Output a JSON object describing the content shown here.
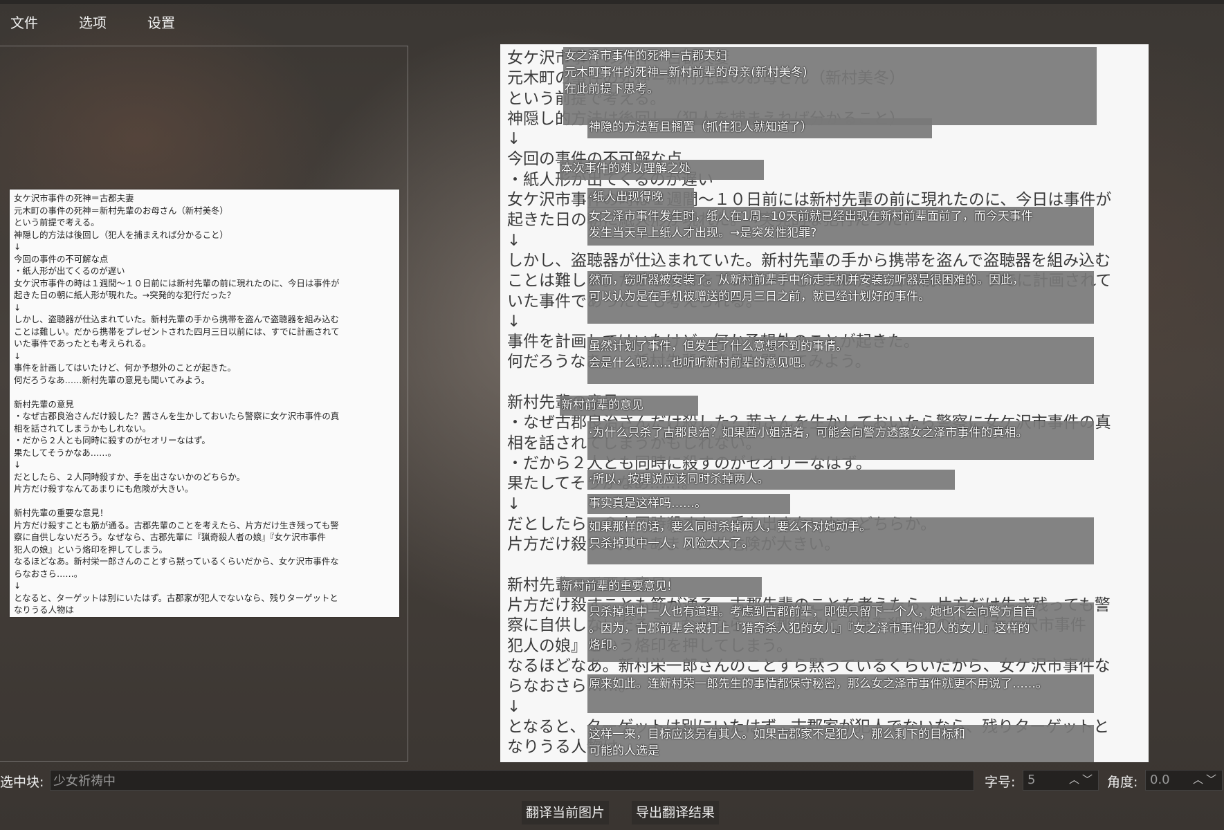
{
  "menu": {
    "file": "文件",
    "options": "选项",
    "settings": "设置"
  },
  "left_image_text": "女ケ沢市事件の死神＝古郡夫妻\n元木町の事件の死神＝新村先輩のお母さん（新村美冬）\nという前提で考える。\n神隠し的方法は後回し（犯人を捕まえれば分かること）\n↓\n今回の事件の不可解な点\n・紙人形が出てくるのが遅い\n女ケ沢市事件の時は１週間〜１０日前には新村先輩の前に現れたのに、今日は事件が\n起きた日の朝に紙人形が現れた。→突発的な犯行だった？\n↓\nしかし、盗聴器が仕込まれていた。新村先輩の手から携帯を盗んで盗聴器を組み込む\nことは難しい。だから携帯をプレゼントされた四月三日以前には、すでに計画されて\nいた事件であったとも考えられる。\n↓\n事件を計画してはいたけど、何か予想外のことが起きた。\n何だろうなあ……新村先輩の意見も聞いてみよう。\n\n新村先輩の意見\n・なぜ古郡良治さんだけ殺した？茜さんを生かしておいたら警察に女ケ沢市事件の真\n相を話されてしまうかもしれない。\n・だから２人とも同時に殺すのがセオリーなはず。\n果たしてそうかなあ……。\n↓\nだとしたら、２人同時殺すか、手を出さないかのどちらか。\n片方だけ殺すなんてあまりにも危険が大きい。\n\n新村先輩の重要な意見！\n片方だけ殺すことも筋が通る。古郡先輩のことを考えたら、片方だけ生き残っても警\n察に自供しないだろう。なぜなら、古郡先輩に『猟奇殺人者の娘』『女ケ沢市事件\n犯人の娘』という烙印を押してしまう。\nなるほどなあ。新村栄一郎さんのことすら黙っているくらいだから、女ケ沢市事件な\nらなおさら……。\n↓\nとなると、ターゲットは別にいたはず。古郡家が犯人でないなら、残りターゲットと\nなりうる人物は",
  "right_image_text": "女ケ沢市事件の死神＝古郡夫妻\n元木町の事件の死神＝新村先輩のお母さん（新村美冬）\nという前提で考える。\n神隠し的方法は後回し（犯人を捕まえれば分かること）\n↓\n今回の事件の不可解な点\n・紙人形が出てくるのが遅い\n女ケ沢市事件の時は１週間〜１０日前には新村先輩の前に現れたのに、今日は事件が\n起きた日の朝に紙人形が現れた。→突発的な犯行だった？\n↓\nしかし、盗聴器が仕込まれていた。新村先輩の手から携帯を盗んで盗聴器を組み込む\nことは難しい。だから携帯をプレゼントされた四月三日以前には、すでに計画されて\nいた事件であったとも考えられる。\n↓\n事件を計画してはいたけど、何か予想外のことが起きた。\n何だろうなあ……新村先輩の意見も聞いてみよう。\n\n新村先輩の意見\n・なぜ古郡良治さんだけ殺した？茜さんを生かしておいたら警察に女ケ沢市事件の真\n相を話されてしまうかもしれない。\n・だから２人とも同時に殺すのがセオリーなはず。\n果たしてそうかなあ……。\n↓\nだとしたら、２人同時殺すか、手を出さないかのどちらか。\n片方だけ殺すなんてあまりにも危険が大きい。\n\n新村先輩の重要な意見！\n片方だけ殺すことも筋が通る。古郡先輩のことを考えたら、片方だけ生き残っても警\n察に自供しないだろう。なぜなら、古郡先輩に『猟奇殺人者の娘』『女ケ沢市事件\n犯人の娘』という烙印を押してしまう。\nなるほどなあ。新村栄一郎さんのことすら黙っているくらいだから、女ケ沢市事件な\nらなおさら……。\n↓\nとなると、ターゲットは別にいたはず。古郡家が犯人でないなら、残りターゲットと\nなりうる人物は",
  "translations": [
    "女之泽市事件的死神=古郡夫妇\n元木町事件的死神=新村前辈的母亲(新村美冬)\n在此前提下思考。",
    "神隐的方法暂且搁置（抓住犯人就知道了）",
    "本次事件的难以理解之处",
    "·纸人出现得晚",
    "女之泽市事件发生时，纸人在1周~10天前就已经出现在新村前辈面前了，而今天事件\n发生当天早上纸人才出现。→是突发性犯罪?",
    "然而，窃听器被安装了。从新村前辈手中偷走手机并安装窃听器是很困难的。因此，\n可以认为是在手机被赠送的四月三日之前，就已经计划好的事件。",
    "虽然计划了事件，但发生了什么意想不到的事情。\n会是什么呢……也听听新村前辈的意见吧。",
    "新村前辈的意见",
    "·为什么只杀了古郡良治？如果茜小姐活着，可能会向警方透露女之泽市事件的真相。",
    "·所以，按理说应该同时杀掉两人。",
    "事实真是这样吗……。",
    "如果那样的话，要么同时杀掉两人，要么不对她动手。\n只杀掉其中一人，风险太大了。",
    "新村前辈的重要意见!",
    "只杀掉其中一人也有道理。考虑到古郡前辈，即使只留下一个人，她也不会向警方自首\n。因为，古郡前辈会被打上『猎奇杀人犯的女儿』『女之泽市事件犯人的女儿』这样的\n烙印。",
    "原来如此。连新村荣一郎先生的事情都保守秘密，那么女之泽市事件就更不用说了……。",
    "这样一来，目标应该另有其人。如果古郡家不是犯人，那么剩下的目标和\n可能的人选是"
  ],
  "bottom": {
    "selected_label": "选中块:",
    "selected_value": "少女祈祷中",
    "font_size_label": "字号:",
    "font_size_value": "5",
    "angle_label": "角度:",
    "angle_value": "0.0",
    "translate_button": "翻译当前图片",
    "export_button": "导出翻译结果"
  }
}
